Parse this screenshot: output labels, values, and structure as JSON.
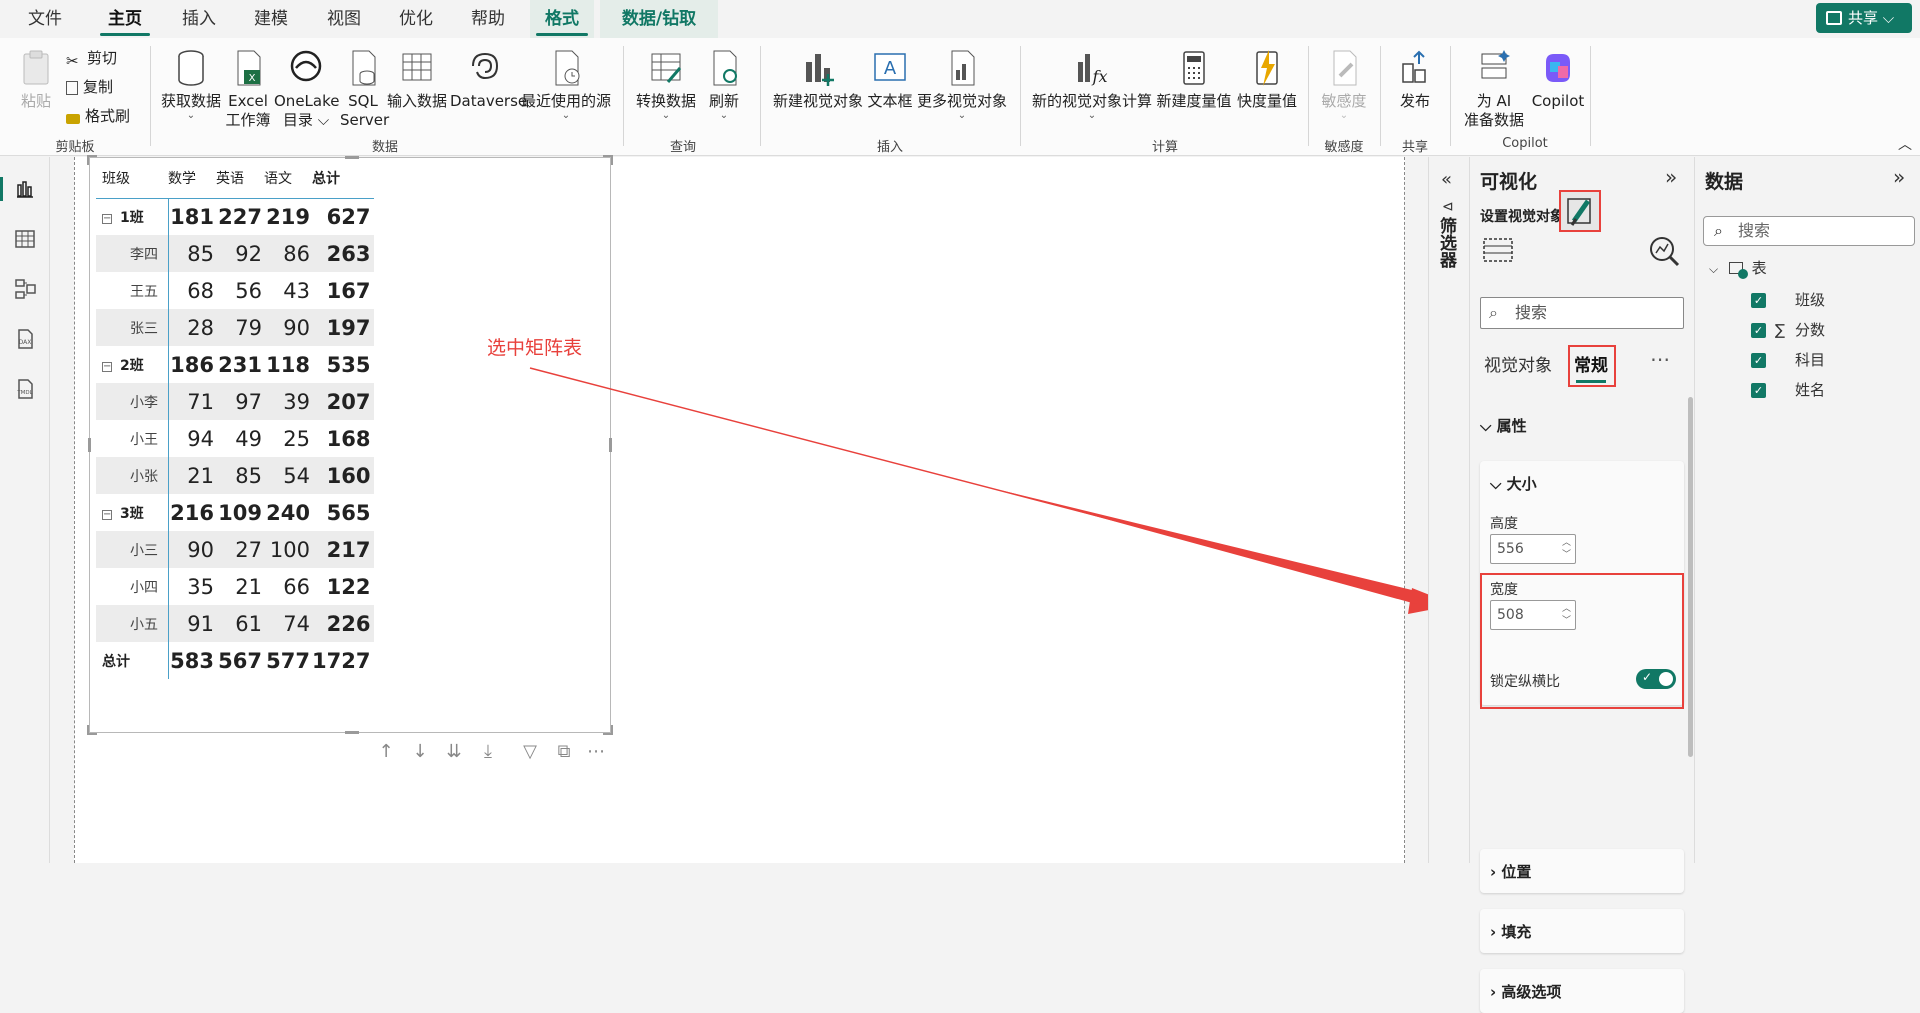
{
  "menu": {
    "items": [
      "文件",
      "主页",
      "插入",
      "建模",
      "视图",
      "优化",
      "帮助"
    ],
    "context_tabs": [
      "格式",
      "数据/钻取"
    ],
    "active": "主页",
    "share_label": "共享"
  },
  "ribbon": {
    "clipboard": {
      "paste": "粘贴",
      "cut": "剪切",
      "copy": "复制",
      "format_painter": "格式刷",
      "group": "剪贴板"
    },
    "data": {
      "get_data": "获取数据",
      "excel_1": "Excel",
      "excel_2": "工作簿",
      "onelake_1": "OneLake",
      "onelake_2": "目录",
      "sql_1": "SQL",
      "sql_2": "Server",
      "enter_data": "输入数据",
      "dataverse": "Dataverse",
      "recent": "最近使用的源",
      "group": "数据"
    },
    "query": {
      "transform": "转换数据",
      "refresh": "刷新",
      "group": "查询"
    },
    "insert": {
      "new_visual": "新建视觉对象",
      "textbox": "文本框",
      "more_visuals": "更多视觉对象",
      "group": "插入"
    },
    "calc": {
      "new_visual_calc": "新的视觉对象计算",
      "new_measure": "新建度量值",
      "quick_measure": "快度量值",
      "group": "计算"
    },
    "sensitivity": {
      "label": "敏感度",
      "group": "敏感度"
    },
    "share": {
      "publish": "发布",
      "group": "共享"
    },
    "copilot": {
      "prep_1": "为 AI",
      "prep_2": "准备数据",
      "copilot": "Copilot",
      "group": "Copilot"
    }
  },
  "matrix": {
    "headers": [
      "班级",
      "数学",
      "英语",
      "语文",
      "总计"
    ],
    "rows": [
      {
        "kind": "group",
        "label": "1班",
        "values": [
          "181",
          "227",
          "219",
          "627"
        ]
      },
      {
        "kind": "child",
        "label": "李四",
        "values": [
          "85",
          "92",
          "86",
          "263"
        ]
      },
      {
        "kind": "child",
        "label": "王五",
        "values": [
          "68",
          "56",
          "43",
          "167"
        ]
      },
      {
        "kind": "child",
        "label": "张三",
        "values": [
          "28",
          "79",
          "90",
          "197"
        ]
      },
      {
        "kind": "group",
        "label": "2班",
        "values": [
          "186",
          "231",
          "118",
          "535"
        ]
      },
      {
        "kind": "child",
        "label": "小李",
        "values": [
          "71",
          "97",
          "39",
          "207"
        ]
      },
      {
        "kind": "child",
        "label": "小王",
        "values": [
          "94",
          "49",
          "25",
          "168"
        ]
      },
      {
        "kind": "child",
        "label": "小张",
        "values": [
          "21",
          "85",
          "54",
          "160"
        ]
      },
      {
        "kind": "group",
        "label": "3班",
        "values": [
          "216",
          "109",
          "240",
          "565"
        ]
      },
      {
        "kind": "child",
        "label": "小三",
        "values": [
          "90",
          "27",
          "100",
          "217"
        ]
      },
      {
        "kind": "child",
        "label": "小四",
        "values": [
          "35",
          "21",
          "66",
          "122"
        ]
      },
      {
        "kind": "child",
        "label": "小五",
        "values": [
          "91",
          "61",
          "74",
          "226"
        ]
      },
      {
        "kind": "total",
        "label": "总计",
        "values": [
          "583",
          "567",
          "577",
          "1727"
        ]
      }
    ]
  },
  "annotation": {
    "text": "选中矩阵表",
    "color": "#e8413c"
  },
  "filter_pane": {
    "label": "筛选器"
  },
  "visualizations": {
    "title": "可视化",
    "subtitle": "设置视觉对象格式",
    "search_placeholder": "搜索",
    "tabs": [
      "视觉对象",
      "常规"
    ],
    "active_tab": "常规",
    "properties": "属性",
    "size_card": {
      "title": "大小",
      "height_label": "高度",
      "height_value": "556",
      "width_label": "宽度",
      "width_value": "508",
      "lock_label": "锁定纵横比",
      "lock_on": true
    },
    "sections": [
      "位置",
      "填充",
      "高级选项"
    ]
  },
  "data_pane": {
    "title": "数据",
    "search_placeholder": "搜索",
    "table_name": "表",
    "fields": [
      "班级",
      "分数",
      "科目",
      "姓名"
    ]
  },
  "colors": {
    "accent": "#117865",
    "highlight": "#e8413c",
    "matrix_line": "#4aa0c8"
  }
}
